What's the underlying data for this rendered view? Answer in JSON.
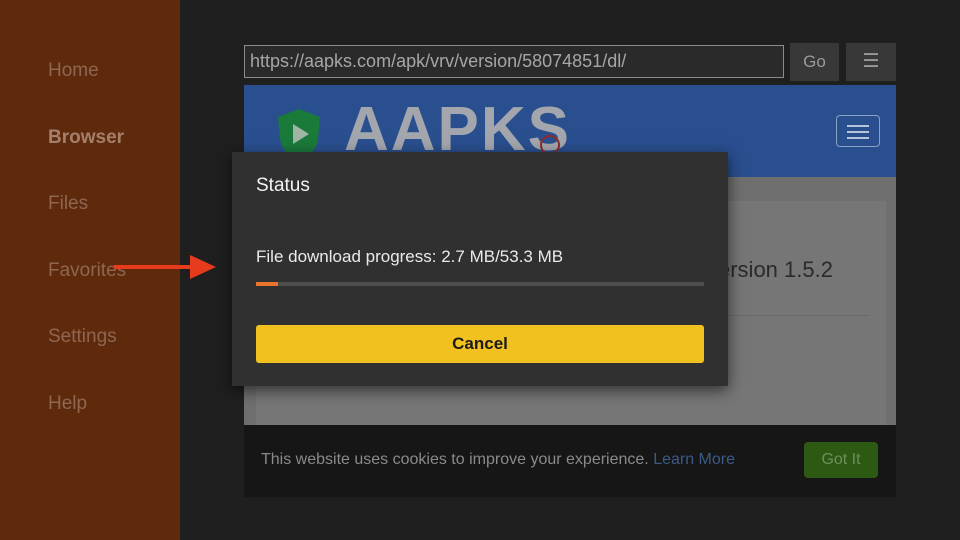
{
  "sidebar": {
    "items": [
      {
        "label": "Home",
        "active": false
      },
      {
        "label": "Browser",
        "active": true
      },
      {
        "label": "Files",
        "active": false
      },
      {
        "label": "Favorites",
        "active": false
      },
      {
        "label": "Settings",
        "active": false
      },
      {
        "label": "Help",
        "active": false
      }
    ]
  },
  "browser": {
    "url": "https://aapks.com/apk/vrv/version/58074851/dl/",
    "go_label": "Go",
    "menu_icon": "hamburger-icon"
  },
  "webpage": {
    "logo_text": "AAPKS",
    "logo_icon": "shield-play-icon",
    "heading_fragment": "ersion 1.5.2"
  },
  "cookie_bar": {
    "text": "This website uses cookies to improve your experience.",
    "link": "Learn More",
    "button": "Got It"
  },
  "dialog": {
    "title": "Status",
    "progress_label": "File download progress: 2.7 MB/53.3 MB",
    "progress_fraction": 0.05,
    "cancel_label": "Cancel"
  },
  "colors": {
    "sidebar_bg": "#5f2a0c",
    "accent_orange": "#e8742e",
    "cancel_yellow": "#f1c21f",
    "arrow_red": "#e63b1c",
    "site_header_blue": "#2a4f8f"
  }
}
